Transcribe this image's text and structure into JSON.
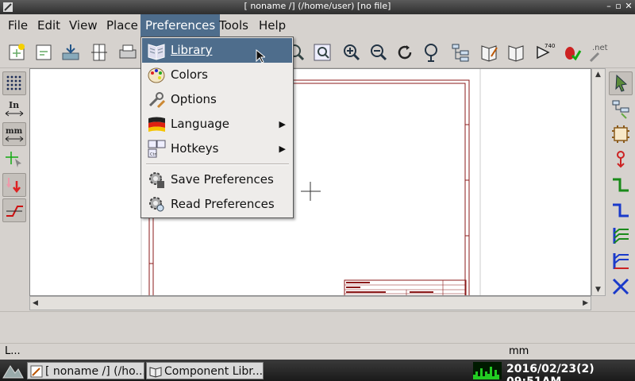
{
  "window": {
    "title": "[ noname /] (/home/user) [no file]"
  },
  "menubar": {
    "items": [
      {
        "label": "File"
      },
      {
        "label": "Edit"
      },
      {
        "label": "View"
      },
      {
        "label": "Place"
      },
      {
        "label": "Preferences"
      },
      {
        "label": "Tools"
      },
      {
        "label": "Help"
      }
    ]
  },
  "preferences_menu": {
    "items": [
      {
        "label": "Library",
        "icon": "library-book-icon"
      },
      {
        "label": "Colors",
        "icon": "palette-icon"
      },
      {
        "label": "Options",
        "icon": "options-tools-icon"
      },
      {
        "label": "Language",
        "icon": "language-flag-icon",
        "submenu": true
      },
      {
        "label": "Hotkeys",
        "icon": "hotkeys-keyboard-icon",
        "submenu": true
      },
      {
        "label": "Save Preferences",
        "icon": "gear-save-icon"
      },
      {
        "label": "Read Preferences",
        "icon": "gear-read-icon"
      }
    ]
  },
  "toolbar": {
    "net_label": ".net",
    "chip_label": "7402"
  },
  "left_toolbar": {
    "inch_label": "In",
    "mm_label": "mm"
  },
  "statusbar": {
    "left_text": "L...",
    "units": "mm"
  },
  "taskbar": {
    "tasks": [
      {
        "label": "[ noname /] (/ho..."
      },
      {
        "label": "Component Libr..."
      }
    ],
    "clock": "2016/02/23(2) 09:51AM"
  },
  "colors": {
    "highlight": "#4e6d8c",
    "sheet_border": "#8b1a1a"
  }
}
